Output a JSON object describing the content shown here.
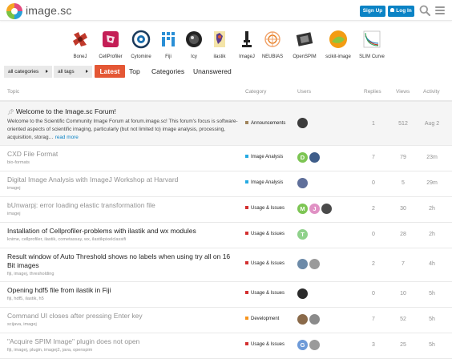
{
  "header": {
    "site_name": "image.sc",
    "signup_label": "Sign Up",
    "login_label": "Log In"
  },
  "partners": [
    {
      "name": "BoneJ",
      "color": "#c0392b"
    },
    {
      "name": "CellProfiler",
      "color": "#c41e56"
    },
    {
      "name": "Cytomine",
      "color": "#1a6fb0"
    },
    {
      "name": "Fiji",
      "color": "#2a8fd6"
    },
    {
      "name": "Icy",
      "color": "#333333"
    },
    {
      "name": "ilastik",
      "color": "#5a3e8f"
    },
    {
      "name": "ImageJ",
      "color": "#222222"
    },
    {
      "name": "NEUBIAS",
      "color": "#e67e22"
    },
    {
      "name": "OpenSPIM",
      "color": "#222222"
    },
    {
      "name": "scikit-image",
      "color": "#f39c12"
    },
    {
      "name": "SLIM Curve",
      "color": "#7f8c8d"
    }
  ],
  "nav": {
    "categories_dropdown": "all categories",
    "tags_dropdown": "all tags",
    "tabs": [
      "Latest",
      "Top",
      "Categories",
      "Unanswered"
    ]
  },
  "table": {
    "headers": [
      "Topic",
      "Category",
      "Users",
      "Replies",
      "Views",
      "Activity"
    ]
  },
  "topics": [
    {
      "title": "Welcome to the Image.sc Forum!",
      "pinned": true,
      "excerpt": "Welcome to the Scientific Community Image Forum at forum.image.sc! This forum's focus is software-oriented aspects of scientific imaging, particularly (but not limited to) image analysis, processing, acquisition, storag…",
      "read_more": "read more",
      "tags": "",
      "category": "Announcements",
      "category_color": "#a0845c",
      "users": [
        {
          "letter": "",
          "color": "#3c3c3c"
        }
      ],
      "replies": "1",
      "views": "512",
      "activity": "Aug 2"
    },
    {
      "title": "CXD File Format",
      "read": true,
      "tags": "bio-formats",
      "category": "Image Analysis",
      "category_color": "#25aae2",
      "users": [
        {
          "letter": "D",
          "color": "#7dc554"
        },
        {
          "letter": "",
          "color": "#3f5e8a"
        }
      ],
      "replies": "7",
      "views": "79",
      "activity": "23m"
    },
    {
      "title": "Digital Image Analysis with ImageJ Workshop at Harvard",
      "read": true,
      "tags": "imagej",
      "category": "Image Analysis",
      "category_color": "#25aae2",
      "users": [
        {
          "letter": "",
          "color": "#5f6f9a"
        }
      ],
      "replies": "0",
      "views": "5",
      "activity": "29m"
    },
    {
      "title": "bUnwarpj: error loading elastic transformation file",
      "read": true,
      "tags": "imagej",
      "category": "Usage & Issues",
      "category_color": "#d32f2f",
      "users": [
        {
          "letter": "M",
          "color": "#7dc554"
        },
        {
          "letter": "J",
          "color": "#e091c4"
        },
        {
          "letter": "",
          "color": "#4a4a4a"
        }
      ],
      "replies": "2",
      "views": "30",
      "activity": "2h"
    },
    {
      "title": "Installation of Cellprofiler-problems with ilastik and wx modules",
      "tags": "knime, cellprofiler, ilastik, cometassay, wx, ilastikpixelclassifi",
      "category": "Usage & Issues",
      "category_color": "#d32f2f",
      "users": [
        {
          "letter": "T",
          "color": "#8fd18b"
        }
      ],
      "replies": "0",
      "views": "28",
      "activity": "2h"
    },
    {
      "title": "Result window of Auto Threshold shows no labels when using try all on 16 Bit images",
      "tags": "fiji, imagej, thresholding",
      "category": "Usage & Issues",
      "category_color": "#d32f2f",
      "users": [
        {
          "letter": "",
          "color": "#6c8aa8"
        },
        {
          "letter": "",
          "color": "#9a9a9a"
        }
      ],
      "replies": "2",
      "views": "7",
      "activity": "4h"
    },
    {
      "title": "Opening hdf5 file from ilastik in Fiji",
      "tags": "fiji, hdf5, ilastik, h5",
      "category": "Usage & Issues",
      "category_color": "#d32f2f",
      "users": [
        {
          "letter": "",
          "color": "#2b2b2b"
        }
      ],
      "replies": "0",
      "views": "10",
      "activity": "5h"
    },
    {
      "title": "Command UI closes after pressing Enter key",
      "read": true,
      "tags": "scijava, imagej",
      "category": "Development",
      "category_color": "#f7941d",
      "users": [
        {
          "letter": "",
          "color": "#8a6a4a"
        },
        {
          "letter": "",
          "color": "#8b8b8b"
        }
      ],
      "replies": "7",
      "views": "52",
      "activity": "5h"
    },
    {
      "title": "\"Acquire SPIM Image\" plugin does not open",
      "read": true,
      "tags": "fiji, imagej, plugin, imagej2, java, openspim",
      "category": "Usage & Issues",
      "category_color": "#d32f2f",
      "users": [
        {
          "letter": "G",
          "color": "#6d9ad8"
        },
        {
          "letter": "",
          "color": "#9a9a9a"
        }
      ],
      "replies": "3",
      "views": "25",
      "activity": "5h"
    }
  ]
}
